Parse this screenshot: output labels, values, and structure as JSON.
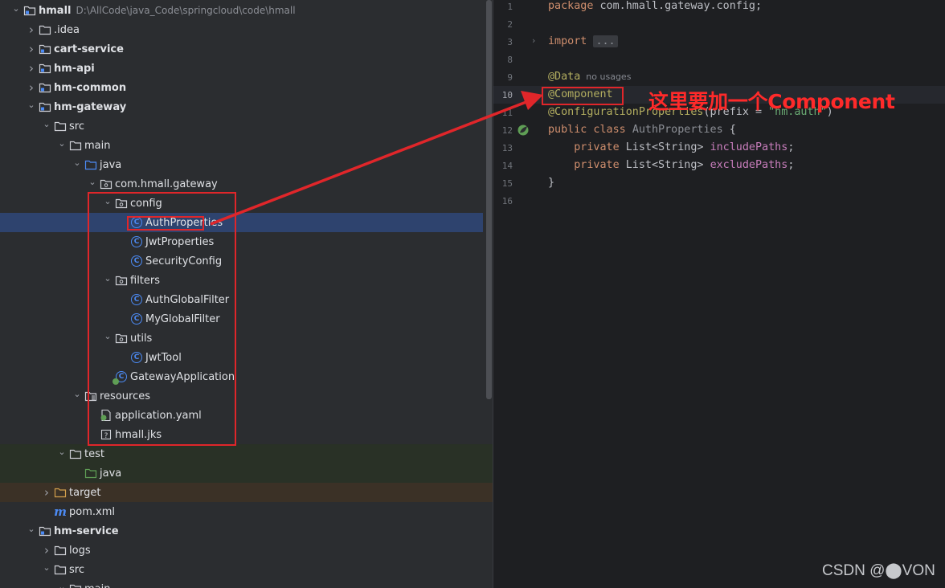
{
  "tree": {
    "items": [
      {
        "label": "hmall",
        "path": "D:\\AllCode\\java_Code\\springcloud\\code\\hmall",
        "depth": 0,
        "expanded": true,
        "icon": "module-folder-icon",
        "bold": true
      },
      {
        "label": ".idea",
        "depth": 1,
        "expanded": false,
        "icon": "folder-icon",
        "bold": false
      },
      {
        "label": "cart-service",
        "depth": 1,
        "expanded": false,
        "icon": "module-folder-icon",
        "bold": true
      },
      {
        "label": "hm-api",
        "depth": 1,
        "expanded": false,
        "icon": "module-folder-icon",
        "bold": true
      },
      {
        "label": "hm-common",
        "depth": 1,
        "expanded": false,
        "icon": "module-folder-icon",
        "bold": true
      },
      {
        "label": "hm-gateway",
        "depth": 1,
        "expanded": true,
        "icon": "module-folder-icon",
        "bold": true
      },
      {
        "label": "src",
        "depth": 2,
        "expanded": true,
        "icon": "folder-icon",
        "bold": false
      },
      {
        "label": "main",
        "depth": 3,
        "expanded": true,
        "icon": "folder-icon",
        "bold": false
      },
      {
        "label": "java",
        "depth": 4,
        "expanded": true,
        "icon": "source-folder-icon",
        "bold": false
      },
      {
        "label": "com.hmall.gateway",
        "depth": 5,
        "expanded": true,
        "icon": "package-icon",
        "bold": false
      },
      {
        "label": "config",
        "depth": 6,
        "expanded": true,
        "icon": "package-icon",
        "bold": false
      },
      {
        "label": "AuthProperties",
        "depth": 7,
        "icon": "class-icon",
        "bold": false,
        "selected": true
      },
      {
        "label": "JwtProperties",
        "depth": 7,
        "icon": "class-icon",
        "bold": false
      },
      {
        "label": "SecurityConfig",
        "depth": 7,
        "icon": "class-icon",
        "bold": false
      },
      {
        "label": "filters",
        "depth": 6,
        "expanded": true,
        "icon": "package-icon",
        "bold": false
      },
      {
        "label": "AuthGlobalFilter",
        "depth": 7,
        "icon": "class-icon",
        "bold": false
      },
      {
        "label": "MyGlobalFilter",
        "depth": 7,
        "icon": "class-icon",
        "bold": false
      },
      {
        "label": "utils",
        "depth": 6,
        "expanded": true,
        "icon": "package-icon",
        "bold": false
      },
      {
        "label": "JwtTool",
        "depth": 7,
        "icon": "class-icon",
        "bold": false
      },
      {
        "label": "GatewayApplication",
        "depth": 6,
        "icon": "spring-class-icon",
        "bold": false
      },
      {
        "label": "resources",
        "depth": 4,
        "expanded": true,
        "icon": "resources-folder-icon",
        "bold": false
      },
      {
        "label": "application.yaml",
        "depth": 5,
        "icon": "yaml-icon",
        "bold": false
      },
      {
        "label": "hmall.jks",
        "depth": 5,
        "icon": "unknown-file-icon",
        "bold": false
      },
      {
        "label": "test",
        "depth": 3,
        "expanded": true,
        "icon": "folder-icon",
        "bold": false,
        "highlight": "green"
      },
      {
        "label": "java",
        "depth": 4,
        "icon": "test-folder-icon",
        "bold": false,
        "highlight": "green"
      },
      {
        "label": "target",
        "depth": 2,
        "expanded": false,
        "icon": "excluded-folder-icon",
        "bold": false,
        "highlight": "brown"
      },
      {
        "label": "pom.xml",
        "depth": 2,
        "icon": "maven-icon",
        "bold": false
      },
      {
        "label": "hm-service",
        "depth": 1,
        "expanded": true,
        "icon": "module-folder-icon",
        "bold": true
      },
      {
        "label": "logs",
        "depth": 2,
        "expanded": false,
        "icon": "folder-icon",
        "bold": false
      },
      {
        "label": "src",
        "depth": 2,
        "expanded": true,
        "icon": "folder-icon",
        "bold": false
      },
      {
        "label": "main",
        "depth": 3,
        "expanded": true,
        "icon": "folder-icon",
        "bold": false
      }
    ]
  },
  "editor": {
    "lines": [
      {
        "num": "1",
        "tokens": [
          {
            "t": "package ",
            "c": "kw"
          },
          {
            "t": "com.hmall.gateway.config;",
            "c": ""
          }
        ]
      },
      {
        "num": "2",
        "tokens": []
      },
      {
        "num": "3",
        "tokens": [
          {
            "t": "import ",
            "c": "kw"
          },
          {
            "t": "...",
            "c": "fold"
          }
        ]
      },
      {
        "num": "8",
        "tokens": []
      },
      {
        "num": "9",
        "tokens": [
          {
            "t": "@Data",
            "c": "ann"
          },
          {
            "t": "  no usages",
            "c": "hint"
          }
        ]
      },
      {
        "num": "10",
        "tokens": [
          {
            "t": "@Component",
            "c": "ann"
          }
        ]
      },
      {
        "num": "11",
        "tokens": [
          {
            "t": "@ConfigurationProperties",
            "c": "ann"
          },
          {
            "t": "(prefix = ",
            "c": ""
          },
          {
            "t": "\"hm.auth\"",
            "c": "str"
          },
          {
            "t": ")",
            "c": ""
          }
        ]
      },
      {
        "num": "12",
        "tokens": [
          {
            "t": "public class ",
            "c": "kw"
          },
          {
            "t": "AuthProperties",
            "c": "dim"
          },
          {
            "t": " {",
            "c": ""
          }
        ]
      },
      {
        "num": "13",
        "tokens": [
          {
            "t": "    private ",
            "c": "kw"
          },
          {
            "t": "List<String> ",
            "c": ""
          },
          {
            "t": "includePaths",
            "c": "fld"
          },
          {
            "t": ";",
            "c": ""
          }
        ]
      },
      {
        "num": "14",
        "tokens": [
          {
            "t": "    private ",
            "c": "kw"
          },
          {
            "t": "List<String> ",
            "c": ""
          },
          {
            "t": "excludePaths",
            "c": "fld"
          },
          {
            "t": ";",
            "c": ""
          }
        ]
      },
      {
        "num": "15",
        "tokens": [
          {
            "t": "}",
            "c": ""
          }
        ]
      },
      {
        "num": "16",
        "tokens": []
      }
    ]
  },
  "annotation": {
    "callout": "这里要加一个Component",
    "color": "#e0262a"
  },
  "watermark": "CSDN @⬤VON"
}
